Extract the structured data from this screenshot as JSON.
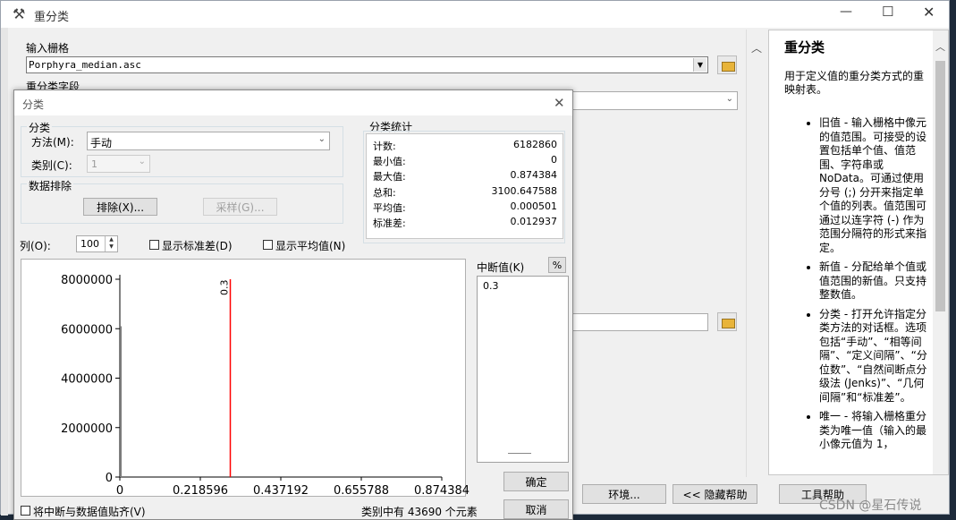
{
  "window": {
    "title": "重分类",
    "input_raster_label": "输入栅格",
    "input_raster_value": "Porphyra_median.asc",
    "reclass_field_label": "重分类字段",
    "buttons": {
      "env": "环境...",
      "hide_help": "<< 隐藏帮助",
      "tool_help": "工具帮助"
    }
  },
  "help": {
    "title": "重分类",
    "intro": "用于定义值的重分类方式的重映射表。",
    "items": [
      "旧值 - 输入栅格中像元的值范围。可接受的设置包括单个值、值范围、字符串或 NoData。可通过使用分号 (;) 分开来指定单个值的列表。值范围可通过以连字符 (-) 作为范围分隔符的形式来指定。",
      "新值 - 分配给单个值或值范围的新值。只支持整数值。",
      "分类 - 打开允许指定分类方法的对话框。选项包括“手动”、“相等间隔”、“定义间隔”、“分位数”、“自然间断点分级法 (Jenks)”、“几何间隔”和“标准差”。",
      "唯一 - 将输入栅格重分类为唯一值（输入的最小像元值为 1，"
    ]
  },
  "dialog": {
    "title": "分类",
    "classify_group": "分类",
    "method_label": "方法(M):",
    "method_value": "手动",
    "classes_label": "类别(C):",
    "classes_value": "1",
    "exclusion_group": "数据排除",
    "exclusion_button": "排除(X)...",
    "sampling_button": "采样(G)...",
    "columns_label": "列(O):",
    "columns_value": "100",
    "show_std_label": "显示标准差(D)",
    "show_mean_label": "显示平均值(N)",
    "stats_group": "分类统计",
    "stats": [
      {
        "label": "计数:",
        "value": "6182860"
      },
      {
        "label": "最小值:",
        "value": "0"
      },
      {
        "label": "最大值:",
        "value": "0.874384"
      },
      {
        "label": "总和:",
        "value": "3100.647588"
      },
      {
        "label": "平均值:",
        "value": "0.000501"
      },
      {
        "label": "标准差:",
        "value": "0.012937"
      }
    ],
    "breaks_label": "中断值(K)",
    "percent_button": "%",
    "breaks": [
      "0.3"
    ],
    "ok": "确定",
    "cancel": "取消",
    "snap_label": "将中断与数据值贴齐(V)",
    "footer_text": "类别中有 43690 个元素"
  },
  "chart_data": {
    "type": "bar",
    "title": "",
    "xlabel": "",
    "ylabel": "",
    "xlim": [
      0,
      0.874384
    ],
    "ylim": [
      0,
      8000000
    ],
    "x_ticks": [
      "0",
      "0.218596",
      "0.437192",
      "0.655788",
      "0.874384"
    ],
    "y_ticks": [
      "0",
      "2000000",
      "4000000",
      "6000000",
      "8000000"
    ],
    "histogram": [
      {
        "x": 0,
        "count": 6100000
      }
    ],
    "break_lines": [
      {
        "x": 0.3,
        "label": "0.3",
        "color": "#ff0000"
      }
    ]
  },
  "watermark": "CSDN @星石传说"
}
